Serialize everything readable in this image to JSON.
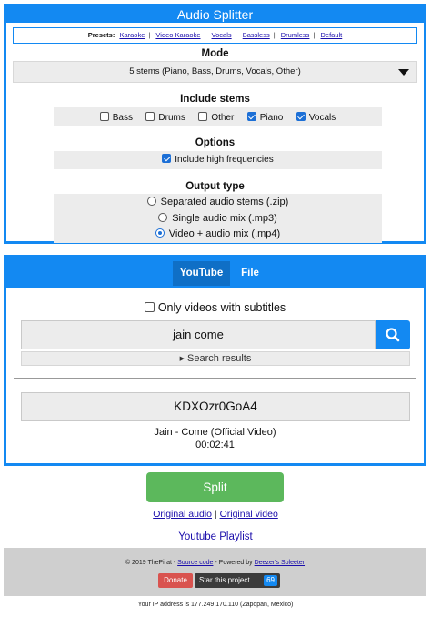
{
  "splitter": {
    "title": "Audio Splitter",
    "presets_label": "Presets:",
    "presets": [
      "Karaoke",
      "Video Karaoke",
      "Vocals",
      "Bassless",
      "Drumless",
      "Default"
    ],
    "mode_title": "Mode",
    "mode_value": "5 stems (Piano, Bass, Drums, Vocals, Other)",
    "stems_title": "Include stems",
    "stems": [
      {
        "label": "Bass",
        "checked": false
      },
      {
        "label": "Drums",
        "checked": false
      },
      {
        "label": "Other",
        "checked": false
      },
      {
        "label": "Piano",
        "checked": true
      },
      {
        "label": "Vocals",
        "checked": true
      }
    ],
    "options_title": "Options",
    "option_high_freq": {
      "label": "Include high frequencies",
      "checked": true
    },
    "output_title": "Output type",
    "output_types": [
      {
        "label": "Separated audio stems (.zip)",
        "selected": false
      },
      {
        "label": "Single audio mix (.mp3)",
        "selected": false
      },
      {
        "label": "Video + audio mix (.mp4)",
        "selected": true
      }
    ]
  },
  "source": {
    "tabs": [
      {
        "label": "YouTube",
        "active": true
      },
      {
        "label": "File",
        "active": false
      }
    ],
    "subtitles_only": {
      "label": "Only videos with subtitles",
      "checked": false
    },
    "search_value": "jain come",
    "search_results_label": "Search results",
    "video_id": "KDXOzr0GoA4",
    "video_title": "Jain - Come (Official Video)",
    "video_duration": "00:02:41"
  },
  "actions": {
    "split_label": "Split",
    "original_audio": "Original audio",
    "separator": "|",
    "original_video": "Original video",
    "playlist": "Youtube Playlist"
  },
  "footer": {
    "credit_prefix": "© 2019 ThePirat -",
    "source_code": "Source code",
    "powered_by": "- Powered by",
    "spleeter_link": "Deezer's Spleeter",
    "donate": "Donate",
    "star": "Star this project",
    "star_count": "69",
    "ip_text": "Your IP address is 177.249.170.110 (Zapopan, Mexico)"
  },
  "colors": {
    "accent": "#1389f2",
    "split_green": "#5cb85c",
    "donate_red": "#d9534f"
  },
  "icons": {
    "search": "search-icon",
    "dropdown": "caret-down-icon",
    "toggle": "caret-right-icon"
  }
}
